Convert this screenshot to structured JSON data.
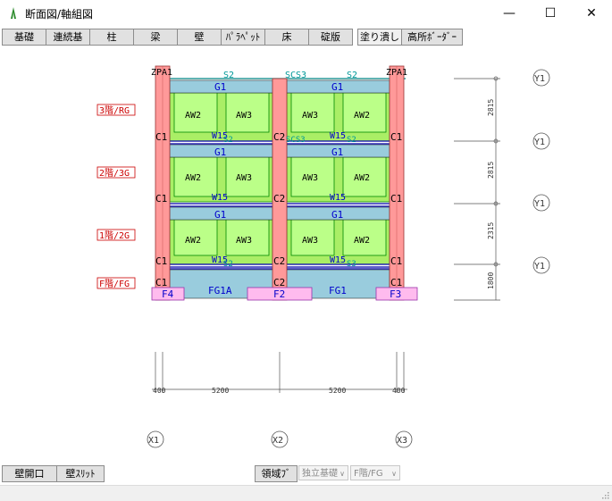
{
  "window": {
    "title": "断面図/軸組図",
    "minimize_glyph": "—",
    "maximize_glyph": "☐",
    "close_glyph": "✕"
  },
  "toolbar": {
    "buttons": [
      "基礎",
      "連続基",
      "柱",
      "梁",
      "壁",
      "ﾊﾟﾗﾍﾟｯﾄ",
      "床",
      "碇版",
      "塗り潰し",
      "高所ﾎﾞｰﾀﾞｰ"
    ]
  },
  "drawing": {
    "floor_labels": [
      "3階/RG",
      "2階/3G",
      "1階/2G",
      "F階/FG"
    ],
    "column_labels": {
      "c1": "C1",
      "c2": "C2"
    },
    "corner_labels": {
      "left": "ZPA1",
      "right": "ZPA1"
    },
    "top_labels": {
      "s2": "S2",
      "scs3": "SCS3"
    },
    "girder_label": "G1",
    "wall_labels": {
      "aw2": "AW2",
      "aw3": "AW3"
    },
    "beam_label": "W15",
    "slab_labels": {
      "s2": "S2",
      "scs3": "SCS3",
      "s3": "S3"
    },
    "foundation_labels": {
      "f4": "F4",
      "f2": "F2",
      "f3": "F3",
      "fg1a": "FG1A",
      "fg1": "FG1"
    },
    "dim_right": [
      "2815",
      "2815",
      "2315",
      "1800"
    ],
    "dim_bottom": [
      "400",
      "5200",
      "5200",
      "400"
    ],
    "y_axis_label": "Y1",
    "x_axis_labels": [
      "X1",
      "X2",
      "X3"
    ]
  },
  "bottombar": {
    "wall_opening": "壁開口",
    "wall_slit": "壁ｽﾘｯﾄ",
    "region": "領域ﾌﾞ",
    "select_independent": "独立基礎",
    "select_floor": "F階/FG",
    "select_arrow": "∨"
  },
  "colors": {
    "column": "#ff9999",
    "girder": "#99ccdd",
    "wall": "#aaee66",
    "opening": "#bbff88",
    "foundation_pink": "#ffbbee",
    "blue_text": "#0000cc",
    "teal_text": "#009999",
    "red_label": "#cc0000"
  }
}
